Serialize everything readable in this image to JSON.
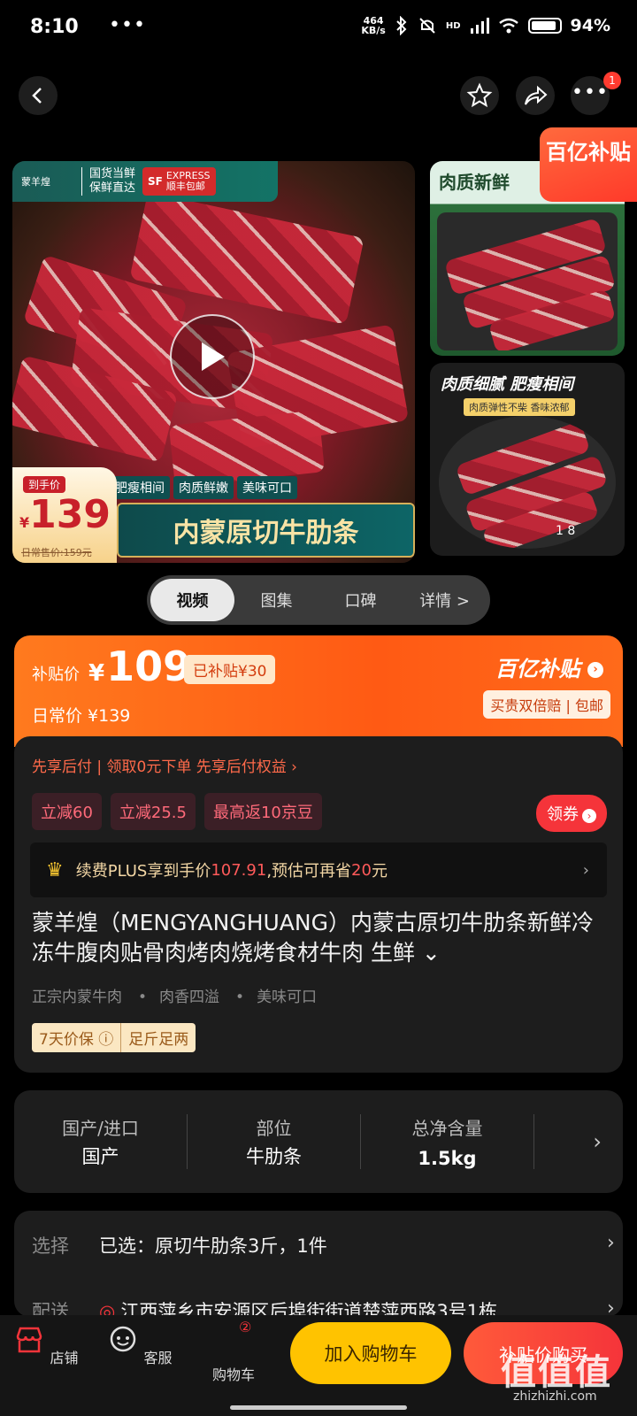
{
  "status_bar": {
    "time": "8:10",
    "dots": "•••",
    "speed_value": "464",
    "speed_unit": "KB/s",
    "network": "HD",
    "battery": "94%"
  },
  "nav": {
    "notification_count": "1"
  },
  "gallery": {
    "brand_name": "蒙羊煌",
    "brand_slogan_1": "国货当鲜",
    "brand_slogan_2": "保鲜直达",
    "sf_logo": "SF",
    "sf_express": "EXPRESS",
    "sf_free": "顺丰包邮",
    "price_label": "到手价",
    "price_currency": "¥",
    "price_value": "139",
    "old_price": "日常售价:159元",
    "feature_tags": [
      "肥瘦相间",
      "肉质鲜嫩",
      "美味可口"
    ],
    "banner_title": "内蒙原切牛肋条",
    "side1_title": "肉质新鲜",
    "side2_title": "肉质细腻 肥瘦相间",
    "side2_sub": "肉质弹性不柴 香味浓郁",
    "counter": "1 8",
    "subsidy_badge": "百亿补贴"
  },
  "tabs": [
    {
      "label": "视频"
    },
    {
      "label": "图集"
    },
    {
      "label": "口碑"
    },
    {
      "label": "详情 >"
    }
  ],
  "price_card": {
    "subsidy_label": "补贴价",
    "currency": "¥",
    "price": "109",
    "saved": "已补贴¥30",
    "regular": "日常价 ¥139",
    "brand": "百亿补贴",
    "brand_arrow": "›",
    "promo": "买贵双倍赔 | 包邮"
  },
  "info": {
    "pay_later": "先享后付 | 领取0元下单 先享后付权益 ›",
    "chips": [
      "立减60",
      "立减25.5",
      "最高返10京豆"
    ],
    "coupon_label": "领券",
    "coupon_arrow": "›",
    "plus_prefix": "续费PLUS享到手价",
    "plus_price": "107.91",
    "plus_mid": ",预估可再省",
    "plus_save": "20",
    "plus_suffix": "元",
    "plus_chevron": "›",
    "title": "蒙羊煌（MENGYANGHUANG）内蒙古原切牛肋条新鲜冷冻牛腹肉贴骨肉烤肉烧烤食材牛肉 生鲜 ⌄",
    "features": [
      "正宗内蒙牛肉",
      "肉香四溢",
      "美味可口"
    ],
    "guarantees": [
      "7天价保 ⓘ",
      "足斤足两"
    ]
  },
  "specs": [
    {
      "key": "国产/进口",
      "value": "国产"
    },
    {
      "key": "部位",
      "value": "牛肋条"
    },
    {
      "key": "总净含量",
      "value": "1.5kg"
    }
  ],
  "spec_chevron": "›",
  "select": {
    "label": "选择",
    "value": "已选：原切牛肋条3斤，1件",
    "chevron": "›",
    "delivery_label": "配送",
    "delivery_value": "江西萍乡市安源区后埠街街道楚萍西路3号1栋",
    "delivery_chevron": "›"
  },
  "bottom": {
    "shop": "店铺",
    "service": "客服",
    "cart": "购物车",
    "cart_badge": "②",
    "add_cart": "加入购物车",
    "buy": "补贴价购买"
  },
  "watermark": {
    "text": "值值值",
    "url": "zhizhizhi.com"
  },
  "colors": {
    "accent_orange": "#ff5a14",
    "accent_red": "#f5343a",
    "cart_yellow": "#ffc300",
    "background": "#000000",
    "card": "#1d1d1d"
  }
}
